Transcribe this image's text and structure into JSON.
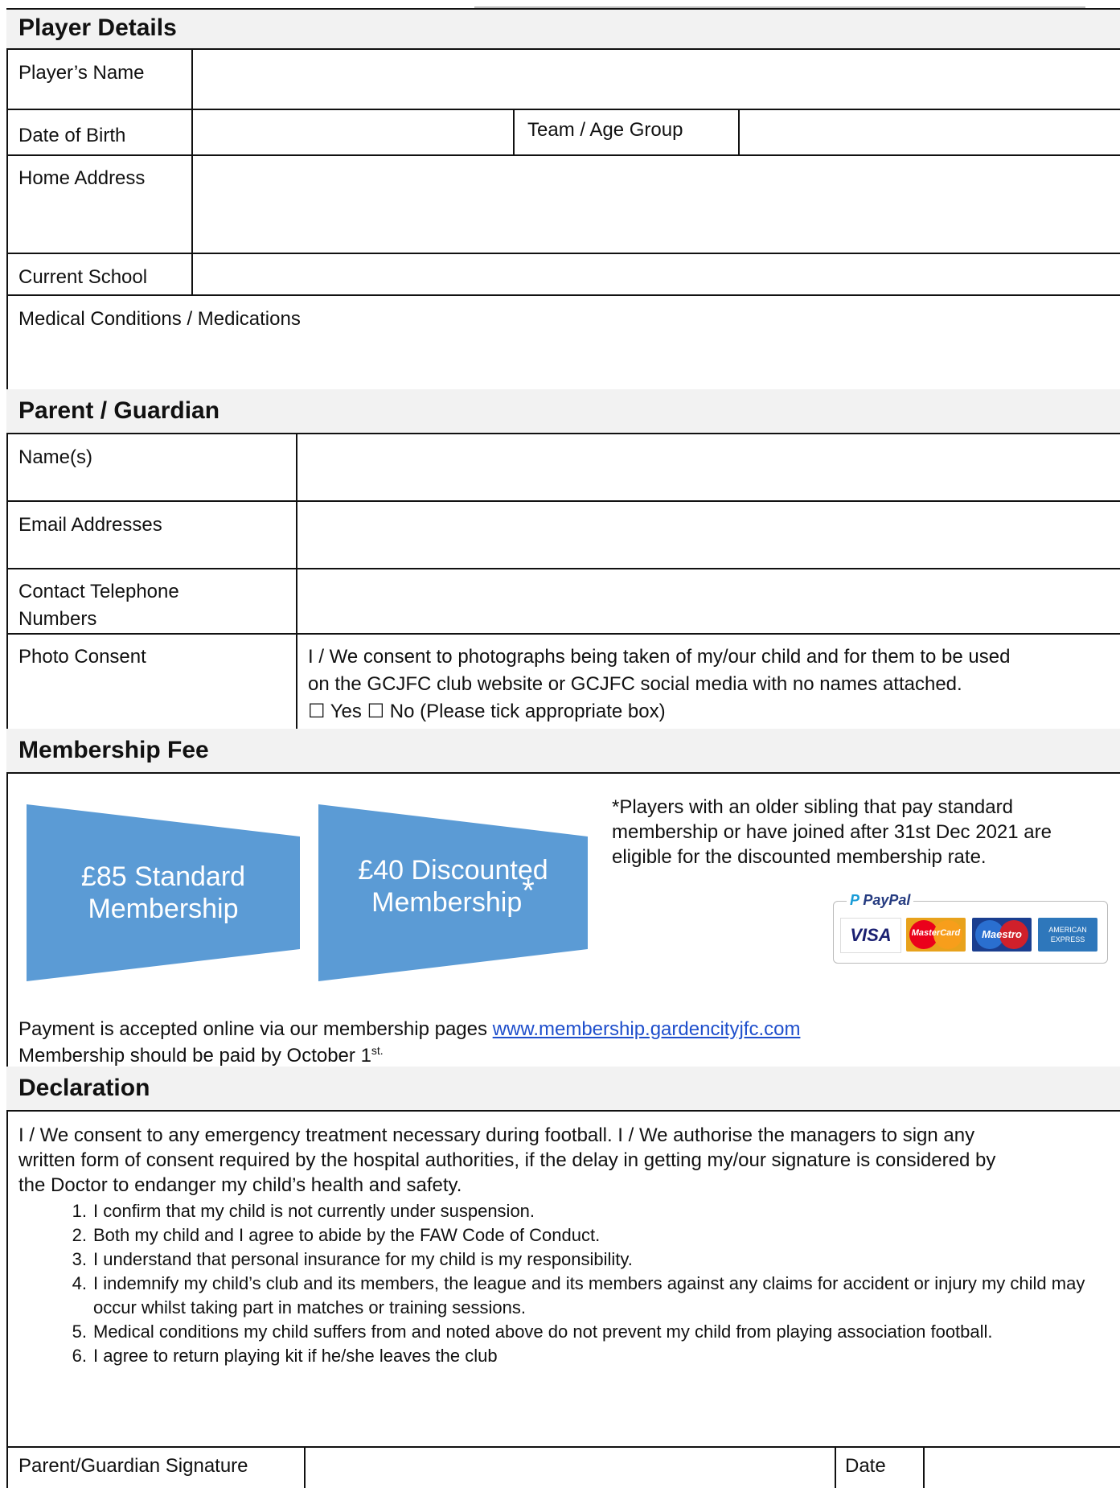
{
  "player": {
    "heading": "Player Details",
    "name_label": "Player’s Name",
    "dob_label": "Date of Birth",
    "team_label": "Team / Age Group",
    "address_label": "Home Address",
    "school_label": "Current School",
    "medical_label": "Medical Conditions / Medications"
  },
  "parent": {
    "heading": "Parent / Guardian",
    "names_label": "Name(s)",
    "email_label": "Email Addresses",
    "phone_label_1": "Contact Telephone",
    "phone_label_2": "Numbers",
    "photo_label": "Photo Consent",
    "photo_text_1": "I / We consent to photographs being taken of my/our child and for them to be used",
    "photo_text_2": "on the GCJFC club website or GCJFC social media with no names attached.",
    "yes_label": "Yes",
    "no_label": "No (Please tick appropriate box)"
  },
  "membership": {
    "heading": "Membership Fee",
    "standard_line1": "£85 Standard",
    "standard_line2": "Membership",
    "discount_line1": "£40 Discounted",
    "discount_line2": "Membership",
    "discount_mark": "*",
    "note_1": "*Players with an older sibling that pay standard",
    "note_2": "membership or have joined after 31st Dec 2021 are",
    "note_3": "eligible for the discounted membership rate.",
    "paypal_label": "PayPal",
    "cards": [
      "VISA",
      "MasterCard",
      "Maestro",
      "AMERICAN EXPRESS"
    ],
    "payment_text": "Payment is accepted online via our membership pages ",
    "payment_link": "www.membership.gardencityjfc.com",
    "deadline_text": "Membership should be paid by October 1",
    "deadline_sup": "st."
  },
  "declaration": {
    "heading": "Declaration",
    "intro_1": "I / We consent to any emergency treatment necessary during football. I / We authorise the managers to sign any",
    "intro_2": "written form of consent required by the hospital authorities, if the delay in getting my/our signature is considered by",
    "intro_3": "the Doctor to endanger my child’s health and safety.",
    "items": [
      {
        "num": "1.",
        "text": "I confirm that my child is not currently under suspension."
      },
      {
        "num": "2.",
        "text": "Both my child and I agree to abide by the FAW Code of Conduct."
      },
      {
        "num": "3.",
        "text": "I understand that personal insurance for my child is my responsibility."
      },
      {
        "num": "4.",
        "text": "I indemnify my child’s club and its members, the league and its members against any claims for accident or injury my child may occur whilst taking part in matches or training sessions."
      },
      {
        "num": "5.",
        "text": "Medical conditions my child suffers from and noted above do not prevent my child from playing association football."
      },
      {
        "num": "6.",
        "text": "I agree to return playing kit if he/she leaves the club"
      }
    ],
    "signature_label": "Parent/Guardian Signature",
    "date_label": "Date"
  },
  "colors": {
    "chevron": "#5b9bd5",
    "header_bg": "#f2f2f2",
    "link": "#1f4fcc"
  }
}
